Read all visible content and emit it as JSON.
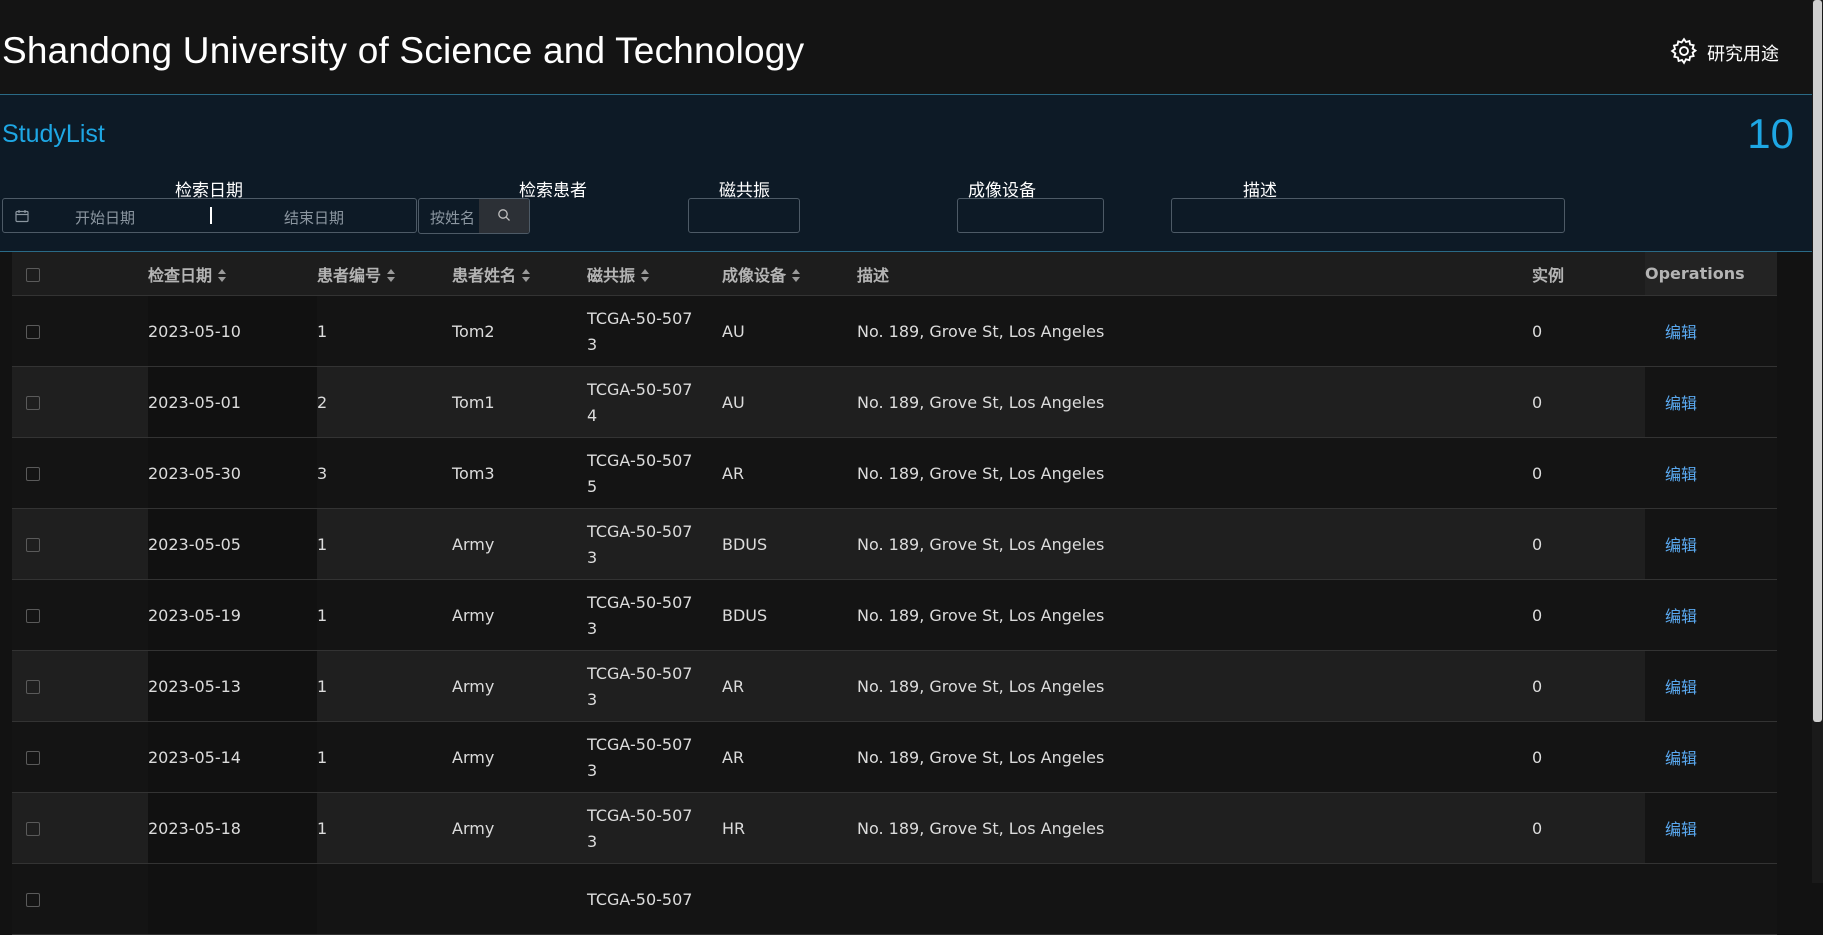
{
  "app": {
    "title": "Shandong University of Science and Technology"
  },
  "settings": {
    "label": "研究用途",
    "icon": "gear-icon"
  },
  "studylist": {
    "title": "StudyList",
    "count": "10"
  },
  "filters": {
    "date_label": "检索日期",
    "date_start_placeholder": "开始日期",
    "date_end_placeholder": "结束日期",
    "patient_label": "检索患者",
    "patient_placeholder": "按姓名",
    "mri_label": "磁共振",
    "device_label": "成像设备",
    "desc_label": "描述"
  },
  "table": {
    "headers": {
      "date": "检查日期",
      "patient_id": "患者编号",
      "patient_name": "患者姓名",
      "mri": "磁共振",
      "device": "成像设备",
      "desc": "描述",
      "instances": "实例",
      "ops": "Operations"
    },
    "edit_label": "编辑",
    "rows": [
      {
        "date": "2023-05-10",
        "pid": "1",
        "name": "Tom2",
        "mri_a": "TCGA-50-507",
        "mri_b": "3",
        "device": "AU",
        "desc": "No. 189, Grove St, Los Angeles",
        "inst": "0"
      },
      {
        "date": "2023-05-01",
        "pid": "2",
        "name": "Tom1",
        "mri_a": "TCGA-50-507",
        "mri_b": "4",
        "device": "AU",
        "desc": "No. 189, Grove St, Los Angeles",
        "inst": "0"
      },
      {
        "date": "2023-05-30",
        "pid": "3",
        "name": "Tom3",
        "mri_a": "TCGA-50-507",
        "mri_b": "5",
        "device": "AR",
        "desc": "No. 189, Grove St, Los Angeles",
        "inst": "0"
      },
      {
        "date": "2023-05-05",
        "pid": "1",
        "name": "Army",
        "mri_a": "TCGA-50-507",
        "mri_b": "3",
        "device": "BDUS",
        "desc": "No. 189, Grove St, Los Angeles",
        "inst": "0"
      },
      {
        "date": "2023-05-19",
        "pid": "1",
        "name": "Army",
        "mri_a": "TCGA-50-507",
        "mri_b": "3",
        "device": "BDUS",
        "desc": "No. 189, Grove St, Los Angeles",
        "inst": "0"
      },
      {
        "date": "2023-05-13",
        "pid": "1",
        "name": "Army",
        "mri_a": "TCGA-50-507",
        "mri_b": "3",
        "device": "AR",
        "desc": "No. 189, Grove St, Los Angeles",
        "inst": "0"
      },
      {
        "date": "2023-05-14",
        "pid": "1",
        "name": "Army",
        "mri_a": "TCGA-50-507",
        "mri_b": "3",
        "device": "AR",
        "desc": "No. 189, Grove St, Los Angeles",
        "inst": "0"
      },
      {
        "date": "2023-05-18",
        "pid": "1",
        "name": "Army",
        "mri_a": "TCGA-50-507",
        "mri_b": "3",
        "device": "HR",
        "desc": "No. 189, Grove St, Los Angeles",
        "inst": "0"
      },
      {
        "date": "",
        "pid": "",
        "name": "",
        "mri_a": "TCGA-50-507",
        "mri_b": "",
        "device": "",
        "desc": "",
        "inst": ""
      }
    ]
  },
  "colors": {
    "accent": "#1ea7e4",
    "link": "#5aa9f0",
    "background": "#121212",
    "filter_bg": "#0d1a26"
  }
}
